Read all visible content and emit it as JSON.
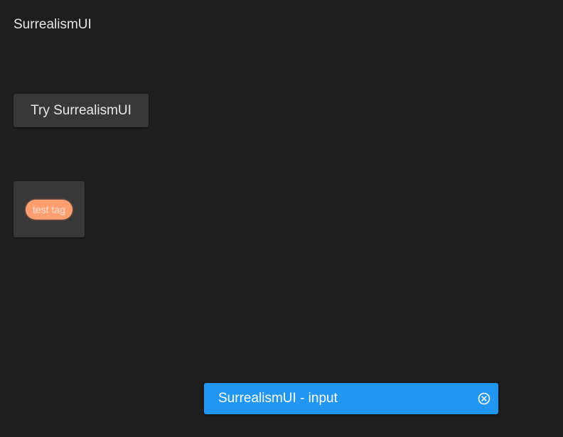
{
  "app": {
    "title": "SurrealismUI"
  },
  "try_button": {
    "label": "Try SurrealismUI"
  },
  "tag_card": {
    "tag_label": "test tag"
  },
  "input": {
    "value": "SurrealismUI - input",
    "clear_icon": "close-circle-icon"
  },
  "colors": {
    "background": "#1e1e1e",
    "card": "#383838",
    "tag": "#ff9f70",
    "input_accent": "#2196f3"
  }
}
